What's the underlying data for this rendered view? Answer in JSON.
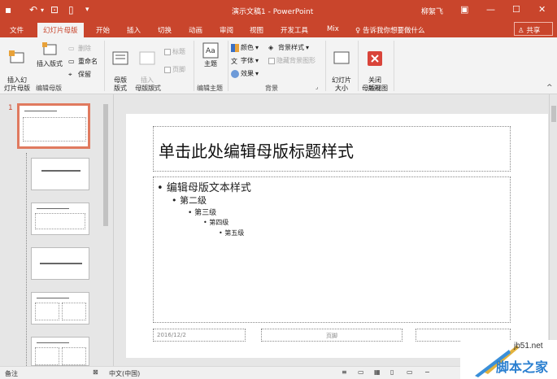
{
  "window": {
    "title": "演示文稿1 - PowerPoint",
    "user": "柳絮飞",
    "share_label": "共享"
  },
  "tabs": [
    "文件",
    "幻灯片母版",
    "开始",
    "插入",
    "切换",
    "动画",
    "审阅",
    "视图",
    "开发工具",
    "Mix"
  ],
  "tell_me": "告诉我你想要做什么",
  "ribbon": {
    "edit_master": {
      "insert_slide_master": "插入幻\n灯片母版",
      "insert_layout": "插入版式",
      "delete": "删除",
      "rename": "重命名",
      "preserve": "保留",
      "label": "编辑母版"
    },
    "master_layout": {
      "master_layout": "母版\n版式",
      "insert_placeholder": "插入\n占位符",
      "title": "标题",
      "footers": "页脚",
      "label": "母版版式"
    },
    "edit_theme": {
      "themes": "主题",
      "label": "编辑主题"
    },
    "background": {
      "colors": "颜色",
      "fonts": "字体",
      "effects": "效果",
      "background_styles": "背景样式",
      "hide_background_graphics": "隐藏背景图形",
      "label": "背景"
    },
    "size": {
      "slide_size": "幻灯片\n大小",
      "label": "大小"
    },
    "close": {
      "close_master_view": "关闭\n母版视图",
      "label": "关闭"
    }
  },
  "thumbnails": {
    "selected_number": "1"
  },
  "slide": {
    "title": "单击此处编辑母版标题样式",
    "levels": [
      "编辑母版文本样式",
      "第二级",
      "第三级",
      "第四级",
      "第五级"
    ],
    "date": "2016/12/2",
    "footer": "页脚"
  },
  "status": {
    "notes": "备注",
    "language": "中文(中国)"
  },
  "watermark": {
    "site": "jb51.net",
    "name": "脚本之家"
  },
  "colors": {
    "accent": "#c9452c"
  }
}
